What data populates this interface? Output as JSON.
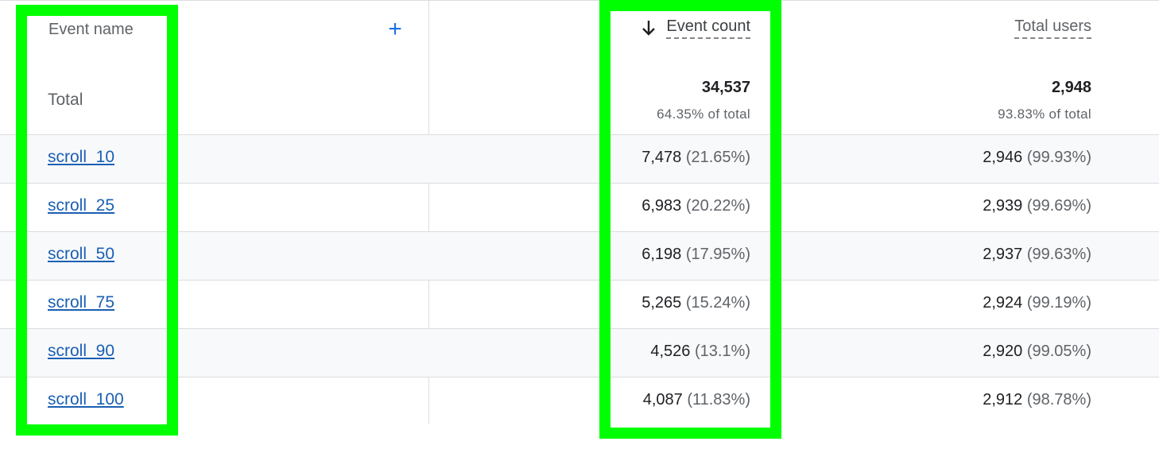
{
  "header": {
    "event_name": "Event name",
    "add_icon": "plus-icon",
    "sort_icon": "arrow-down-icon",
    "event_count": "Event count",
    "total_users": "Total users"
  },
  "totals": {
    "label": "Total",
    "event_count": "34,537",
    "event_count_pct": "64.35% of total",
    "total_users": "2,948",
    "total_users_pct": "93.83% of total"
  },
  "rows": [
    {
      "name": "scroll_10",
      "event_count": "7,478",
      "event_count_pct": "(21.65%)",
      "total_users": "2,946",
      "total_users_pct": "(99.93%)"
    },
    {
      "name": "scroll_25",
      "event_count": "6,983",
      "event_count_pct": "(20.22%)",
      "total_users": "2,939",
      "total_users_pct": "(99.69%)"
    },
    {
      "name": "scroll_50",
      "event_count": "6,198",
      "event_count_pct": "(17.95%)",
      "total_users": "2,937",
      "total_users_pct": "(99.63%)"
    },
    {
      "name": "scroll_75",
      "event_count": "5,265",
      "event_count_pct": "(15.24%)",
      "total_users": "2,924",
      "total_users_pct": "(99.19%)"
    },
    {
      "name": "scroll_90",
      "event_count": "4,526",
      "event_count_pct": "(13.1%)",
      "total_users": "2,920",
      "total_users_pct": "(99.05%)"
    },
    {
      "name": "scroll_100",
      "event_count": "4,087",
      "event_count_pct": "(11.83%)",
      "total_users": "2,912",
      "total_users_pct": "(98.78%)"
    }
  ],
  "colors": {
    "link": "#1a5fb4",
    "accent": "#1a73e8",
    "highlight": "#00ff00",
    "row_shade": "#f8f9fa"
  }
}
